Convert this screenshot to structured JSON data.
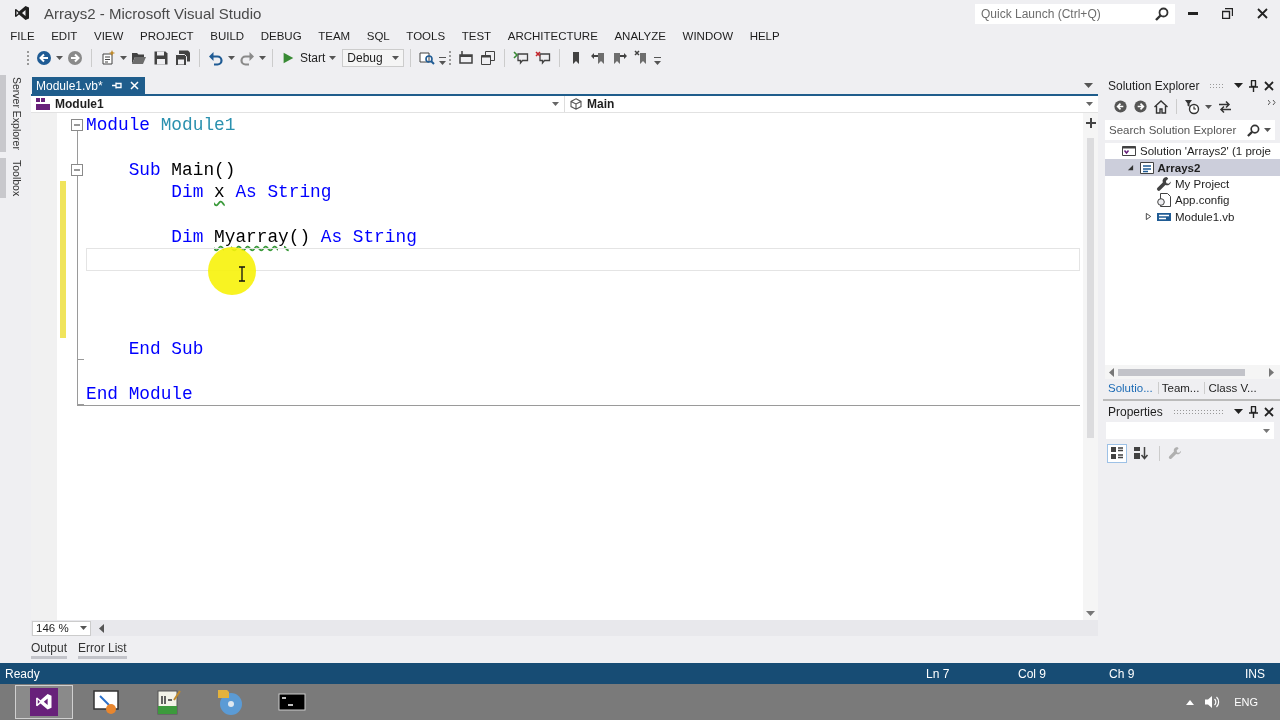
{
  "window": {
    "title": "Arrays2 - Microsoft Visual Studio"
  },
  "quick_launch": {
    "placeholder": "Quick Launch (Ctrl+Q)"
  },
  "menu": [
    "FILE",
    "EDIT",
    "VIEW",
    "PROJECT",
    "BUILD",
    "DEBUG",
    "TEAM",
    "SQL",
    "TOOLS",
    "TEST",
    "ARCHITECTURE",
    "ANALYZE",
    "WINDOW",
    "HELP"
  ],
  "toolbar": {
    "start_button": "Start",
    "configuration": "Debug"
  },
  "side_tabs": [
    "Server Explorer",
    "Toolbox"
  ],
  "document_tabs": [
    {
      "label": "Module1.vb*",
      "selected": true
    }
  ],
  "navigation_bar": {
    "type": "Module1",
    "member": "Main"
  },
  "editor": {
    "lines": [
      {
        "kind": "start",
        "expanded": true,
        "tokens": [
          {
            "kind": "keyword",
            "text": "Module"
          },
          {
            "kind": "type",
            "text": " Module1"
          }
        ],
        "changed": false,
        "current": false
      },
      {
        "kind": "body",
        "changed": false,
        "current": false
      },
      {
        "kind": "start",
        "expanded": true,
        "tokens": [
          {
            "kind": "keyword",
            "text": "    Sub"
          },
          {
            "kind": "plain",
            "text": " Main()"
          }
        ],
        "changed": false,
        "current": false
      },
      {
        "kind": "body",
        "tokens": [
          {
            "kind": "keyword",
            "text": "        Dim "
          },
          {
            "kind": "warning",
            "text": "x"
          },
          {
            "kind": "keyword",
            "text": " As String"
          }
        ],
        "changed": true,
        "current": false
      },
      {
        "kind": "body",
        "changed": true,
        "current": false
      },
      {
        "kind": "body",
        "tokens": [
          {
            "kind": "keyword",
            "text": "        Dim "
          },
          {
            "kind": "warning",
            "text": "Myarray"
          },
          {
            "kind": "plain",
            "text": "() "
          },
          {
            "kind": "keyword",
            "text": "As String"
          }
        ],
        "changed": true,
        "current": false
      },
      {
        "kind": "body",
        "changed": true,
        "current": true
      },
      {
        "kind": "body",
        "changed": true,
        "current": false
      },
      {
        "kind": "body",
        "changed": true,
        "current": false
      },
      {
        "kind": "body",
        "changed": true,
        "current": false
      },
      {
        "kind": "end",
        "tokens": [
          {
            "kind": "keyword",
            "text": "    End Sub"
          }
        ],
        "changed": false,
        "current": false
      },
      {
        "kind": "body",
        "changed": false,
        "current": false
      },
      {
        "kind": "end",
        "tokens": [
          {
            "kind": "keyword",
            "text": "End Module"
          }
        ],
        "changed": false,
        "current": false
      }
    ],
    "zoom": "146 %"
  },
  "bottom_tabs": [
    "Output",
    "Error List"
  ],
  "solution_explorer": {
    "title": "Solution Explorer",
    "search": {
      "placeholder": "Search Solution Explorer"
    },
    "tree": [
      {
        "label": "Solution 'Arrays2' (1 proje",
        "kind": "solution",
        "selected": false,
        "children": [
          {
            "label": "Arrays2",
            "kind": "vb-project",
            "selected": true,
            "expanded": true,
            "children": [
              {
                "label": "My Project",
                "kind": "properties",
                "selected": false
              },
              {
                "label": "App.config",
                "kind": "config",
                "selected": false
              },
              {
                "label": "Module1.vb",
                "kind": "vb-file",
                "selected": false,
                "expanded": false
              }
            ]
          }
        ]
      }
    ],
    "tabs": [
      {
        "label": "Solutio...",
        "selected": true
      },
      {
        "label": "Team...",
        "selected": false
      },
      {
        "label": "Class V...",
        "selected": false
      }
    ]
  },
  "properties": {
    "title": "Properties",
    "view_buttons": [
      {
        "kind": "categorized",
        "selected": true
      },
      {
        "kind": "alphabetical",
        "selected": false
      }
    ],
    "property_pages": {
      "disabled": true
    }
  },
  "status_bar": {
    "message": "Ready",
    "line": "Ln 7",
    "column": "Col 9",
    "character": "Ch 9",
    "mode": "INS"
  },
  "taskbar": {
    "apps": [
      {
        "kind": "logo",
        "selected": true
      },
      {
        "kind": "drawing",
        "selected": false
      },
      {
        "kind": "notepad",
        "selected": false
      },
      {
        "kind": "disc",
        "selected": false
      },
      {
        "kind": "console",
        "selected": false
      }
    ],
    "language": "ENG"
  }
}
